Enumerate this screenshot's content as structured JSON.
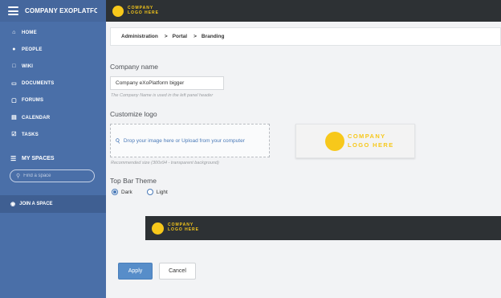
{
  "sidebar": {
    "title": "COMPANY EXOPLATFORM BIGGER",
    "items": [
      {
        "label": "HOME",
        "icon": "home-icon"
      },
      {
        "label": "PEOPLE",
        "icon": "people-icon"
      },
      {
        "label": "WIKI",
        "icon": "wiki-icon"
      },
      {
        "label": "DOCUMENTS",
        "icon": "folder-icon"
      },
      {
        "label": "FORUMS",
        "icon": "forums-icon"
      },
      {
        "label": "CALENDAR",
        "icon": "calendar-icon"
      },
      {
        "label": "TASKS",
        "icon": "tasks-icon"
      }
    ],
    "spaces_label": "MY SPACES",
    "search_placeholder": "Find a space",
    "join_label": "JOIN A SPACE"
  },
  "logo": {
    "line1": "COMPANY",
    "line2": "LOGO HERE"
  },
  "breadcrumb": {
    "items": [
      "Administration",
      "Portal",
      "Branding"
    ],
    "separator": ">"
  },
  "form": {
    "company_name_label": "Company name",
    "company_name_value": "Company eXoPlatform bigger",
    "company_name_hint": "The Company Name is used in the left panel header",
    "logo_label": "Customize logo",
    "dropzone_text": "Drop your image here or Upload from your computer",
    "logo_hint": "Recommended size (300x94 - transparent background)",
    "theme_label": "Top Bar Theme",
    "theme_options": [
      {
        "label": "Dark",
        "selected": true
      },
      {
        "label": "Light",
        "selected": false
      }
    ]
  },
  "buttons": {
    "apply": "Apply",
    "cancel": "Cancel"
  },
  "colors": {
    "sidebar": "#4a6fa8",
    "topbar": "#2d3134",
    "accent": "#578dc9",
    "logo": "#f7c81b"
  }
}
